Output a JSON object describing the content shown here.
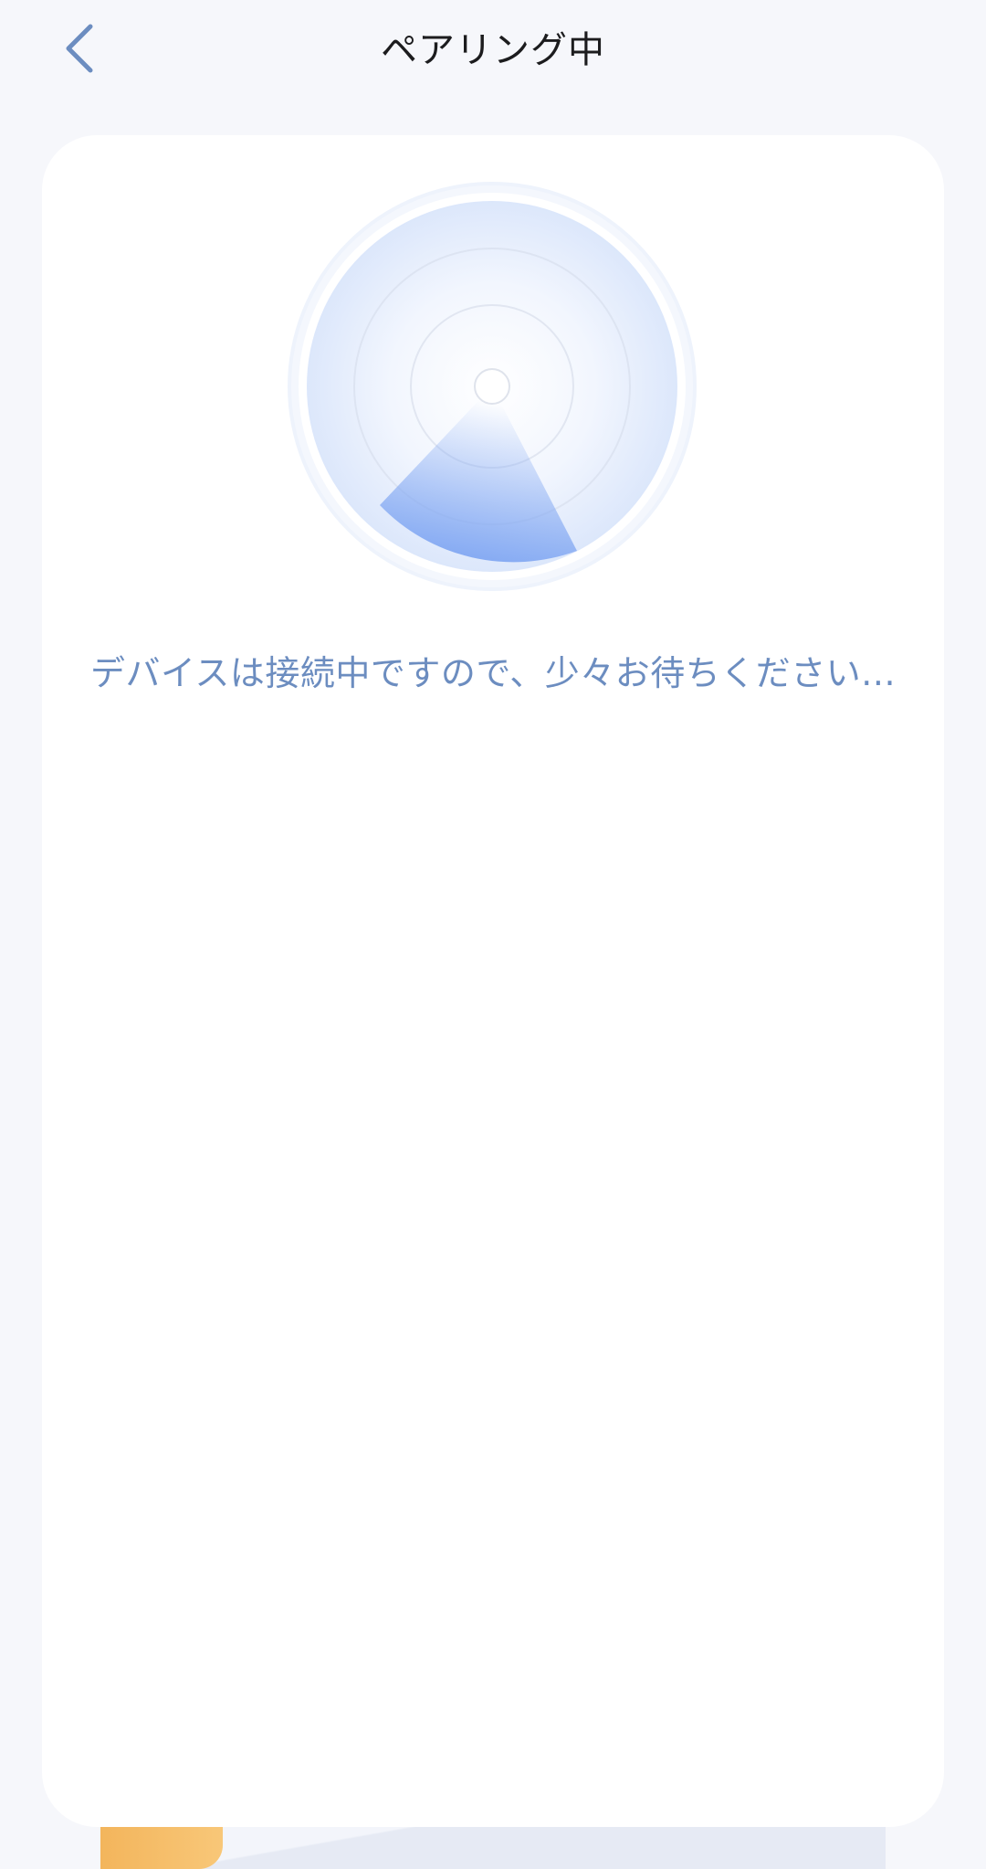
{
  "header": {
    "title": "ペアリング中",
    "back_icon": "chevron-left-icon"
  },
  "main": {
    "status_message": "デバイスは接続中ですので、少々お待ちください...",
    "animation_icon": "radar-scan-icon"
  },
  "colors": {
    "background": "#f6f7fb",
    "card": "#ffffff",
    "accent": "#6c8dc0",
    "radar_sweep": "#7ea5f2",
    "title": "#1c1c1e"
  }
}
